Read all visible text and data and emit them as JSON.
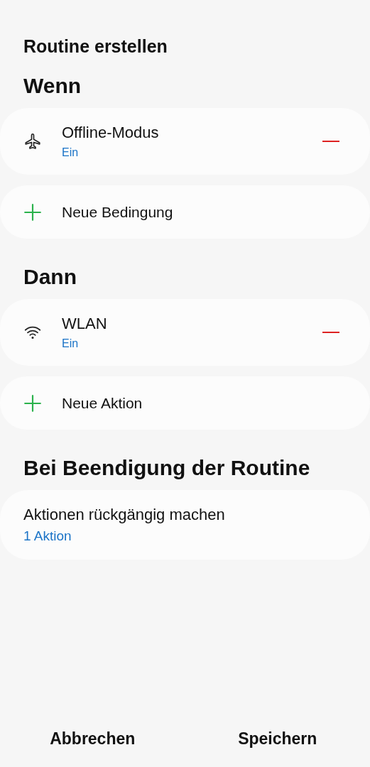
{
  "title": "Routine erstellen",
  "sections": [
    {
      "heading": "Wenn",
      "items": [
        {
          "kind": "entry",
          "name": "Offline-Modus",
          "status": "Ein"
        },
        {
          "kind": "add",
          "label": "Neue Bedingung"
        }
      ]
    },
    {
      "heading": "Dann",
      "items": [
        {
          "kind": "entry",
          "name": "WLAN",
          "status": "Ein"
        },
        {
          "kind": "add",
          "label": "Neue Aktion"
        }
      ]
    }
  ],
  "ending": {
    "heading": "Bei Beendigung der Routine",
    "title": "Aktionen rückgängig machen",
    "detail": "1 Aktion"
  },
  "buttons": [
    "Abbrechen",
    "Speichern"
  ]
}
